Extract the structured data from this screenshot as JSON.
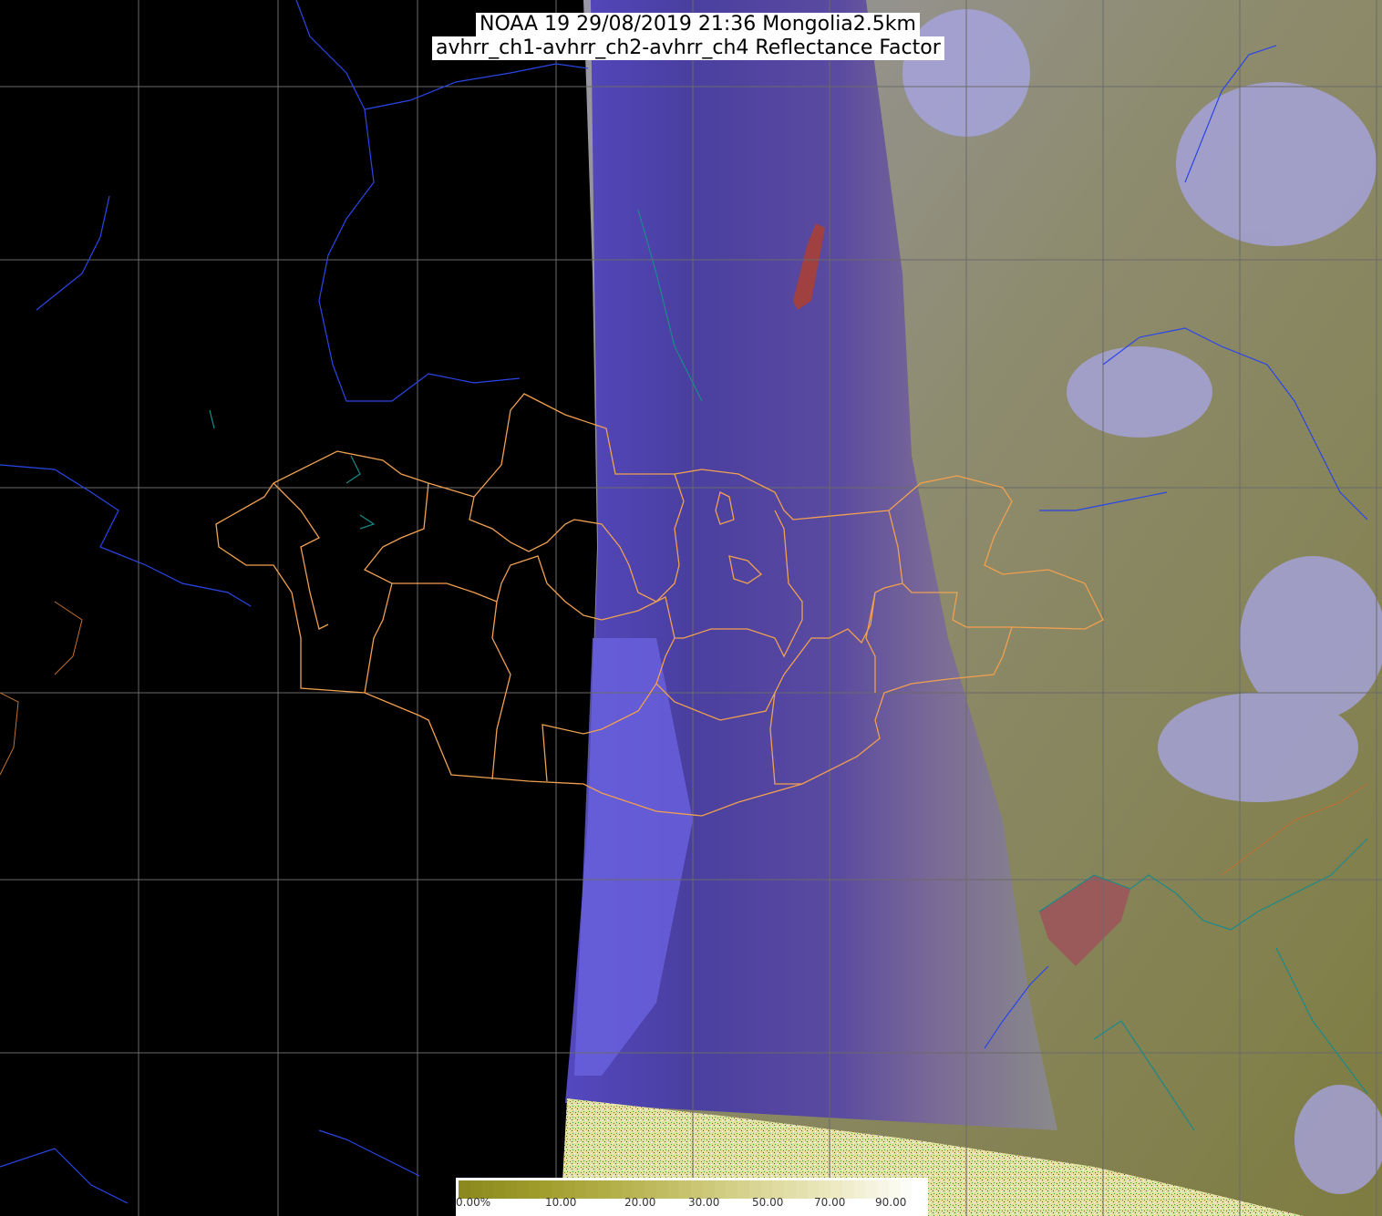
{
  "title": {
    "line1": "NOAA 19 29/08/2019 21:36 Mongolia2.5km",
    "line2": "avhrr_ch1-avhrr_ch2-avhrr_ch4 Reflectance Factor"
  },
  "legend": {
    "ticks": [
      "0.00%",
      "10.00",
      "20.00",
      "30.00",
      "50.00",
      "70.00",
      "90.00"
    ],
    "colors": [
      "#8c8a1e",
      "#a09c2c",
      "#b4b04a",
      "#c8c470",
      "#dcd89a",
      "#eeecc8",
      "#ffffff"
    ]
  },
  "colors": {
    "background": "#000000",
    "grid": "#707070",
    "border_admin": "#f0a050",
    "rivers": "#2040e0",
    "coast": "#1a7a7a",
    "swath_violet": "#4a3fa8",
    "cloud_bright": "#7a78f0",
    "land_olive": "#8e8e58",
    "noise_yellow": "#e6e3a0"
  }
}
